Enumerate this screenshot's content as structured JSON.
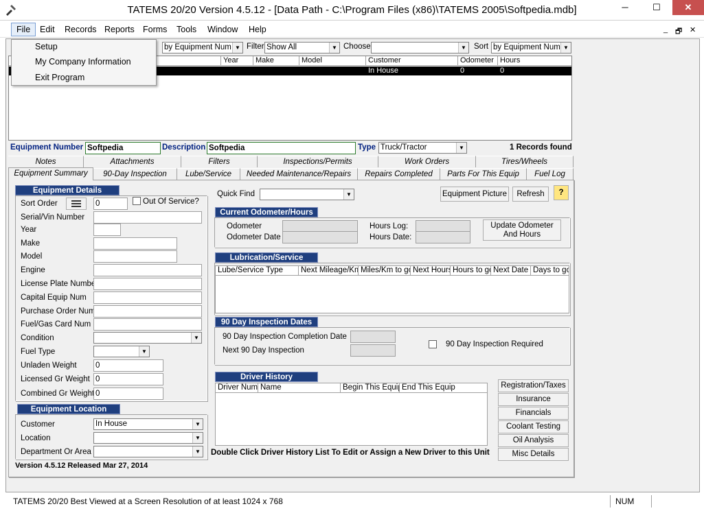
{
  "window": {
    "title": "TATEMS 20/20 Version 4.5.12 - [Data Path - C:\\Program Files (x86)\\TATEMS 2005\\Softpedia.mdb]",
    "minimize": "─",
    "maximize": "☐",
    "close": "✕"
  },
  "menu": {
    "items": [
      "File",
      "Edit",
      "Records",
      "Reports",
      "Forms",
      "Tools",
      "Window",
      "Help"
    ],
    "mdi_min": "_",
    "mdi_restore": "🗗",
    "mdi_close": "✕"
  },
  "file_menu": {
    "items": [
      "Setup",
      "My Company Information",
      "Exit Program"
    ]
  },
  "toolbar": {
    "search_by_value": "by Equipment Num",
    "filter_label": "Filter",
    "filter_value": "Show All",
    "choose_label": "Choose",
    "choose_value": "",
    "sort_label": "Sort",
    "sort_value": "by Equipment Num"
  },
  "grid": {
    "columns": [
      "Year",
      "Make",
      "Model",
      "Customer",
      "Odometer",
      "Hours"
    ],
    "rows": [
      {
        "year": "",
        "make": "",
        "model": "",
        "customer": "In House",
        "odometer": "0",
        "hours": "0"
      }
    ]
  },
  "record": {
    "equipment_number_label": "Equipment Number",
    "equipment_number": "Softpedia",
    "description_label": "Description",
    "description": "Softpedia",
    "type_label": "Type",
    "type": "Truck/Tractor",
    "records_found": "1 Records found"
  },
  "tabs_row1": [
    "Notes",
    "Attachments",
    "Filters",
    "Inspections/Permits",
    "Work Orders",
    "Tires/Wheels"
  ],
  "tabs_row2": [
    "Equipment Summary",
    "90-Day Inspection",
    "Lube/Service",
    "Needed Maintenance/Repairs",
    "Repairs Completed",
    "Parts For This Equip",
    "Fuel Log"
  ],
  "equipment_details": {
    "header": "Equipment Details",
    "sort_order_label": "Sort Order",
    "sort_order": "0",
    "out_of_service_label": "Out Of Service?",
    "serial_label": "Serial/Vin Number",
    "year_label": "Year",
    "make_label": "Make",
    "model_label": "Model",
    "engine_label": "Engine",
    "license_label": "License Plate Number",
    "capital_label": "Capital Equip Num",
    "po_label": "Purchase Order Num",
    "fuel_card_label": "Fuel/Gas Card Num",
    "condition_label": "Condition",
    "fuel_type_label": "Fuel Type",
    "unladen_label": "Unladen Weight",
    "unladen": "0",
    "licensed_gr_label": "Licensed Gr Weight",
    "licensed_gr": "0",
    "combined_gr_label": "Combined Gr Weight",
    "combined_gr": "0"
  },
  "equipment_location": {
    "header": "Equipment Location",
    "customer_label": "Customer",
    "customer": "In House",
    "location_label": "Location",
    "department_label": "Department Or Area"
  },
  "version_text": "Version 4.5.12 Released Mar 27, 2014",
  "quick_find": {
    "label": "Quick Find",
    "equipment_picture": "Equipment Picture",
    "refresh": "Refresh",
    "help": "?"
  },
  "odometer": {
    "header": "Current Odometer/Hours",
    "odometer_label": "Odometer",
    "odometer_date_label": "Odometer Date",
    "hours_log_label": "Hours Log:",
    "hours_date_label": "Hours Date:",
    "update_button_line1": "Update Odometer",
    "update_button_line2": "And  Hours"
  },
  "lubrication": {
    "header": "Lubrication/Service",
    "columns": [
      "Lube/Service Type",
      "Next Mileage/Km",
      "Miles/Km to go",
      "Next Hours",
      "Hours to go",
      "Next Date",
      "Days to go"
    ]
  },
  "inspection90": {
    "header": "90 Day Inspection Dates",
    "completion_label": "90 Day Inspection Completion Date",
    "next_label": "Next 90 Day Inspection",
    "required_label": "90 Day Inspection Required"
  },
  "driver_history": {
    "header": "Driver History",
    "columns": [
      "Driver Num",
      "Name",
      "Begin This Equip",
      "End This Equip"
    ],
    "hint": "Double Click Driver History List To Edit or Assign a New Driver to this Unit"
  },
  "side_buttons": [
    "Registration/Taxes",
    "Insurance",
    "Financials",
    "Coolant Testing",
    "Oil Analysis",
    "Misc Details"
  ],
  "status": {
    "message": "TATEMS 20/20 Best Viewed at a Screen Resolution of at least 1024 x 768",
    "num": "NUM"
  },
  "colors": {
    "section_header": "#1f3f7f",
    "close_button": "#c7504f",
    "label_blue": "#002080"
  }
}
